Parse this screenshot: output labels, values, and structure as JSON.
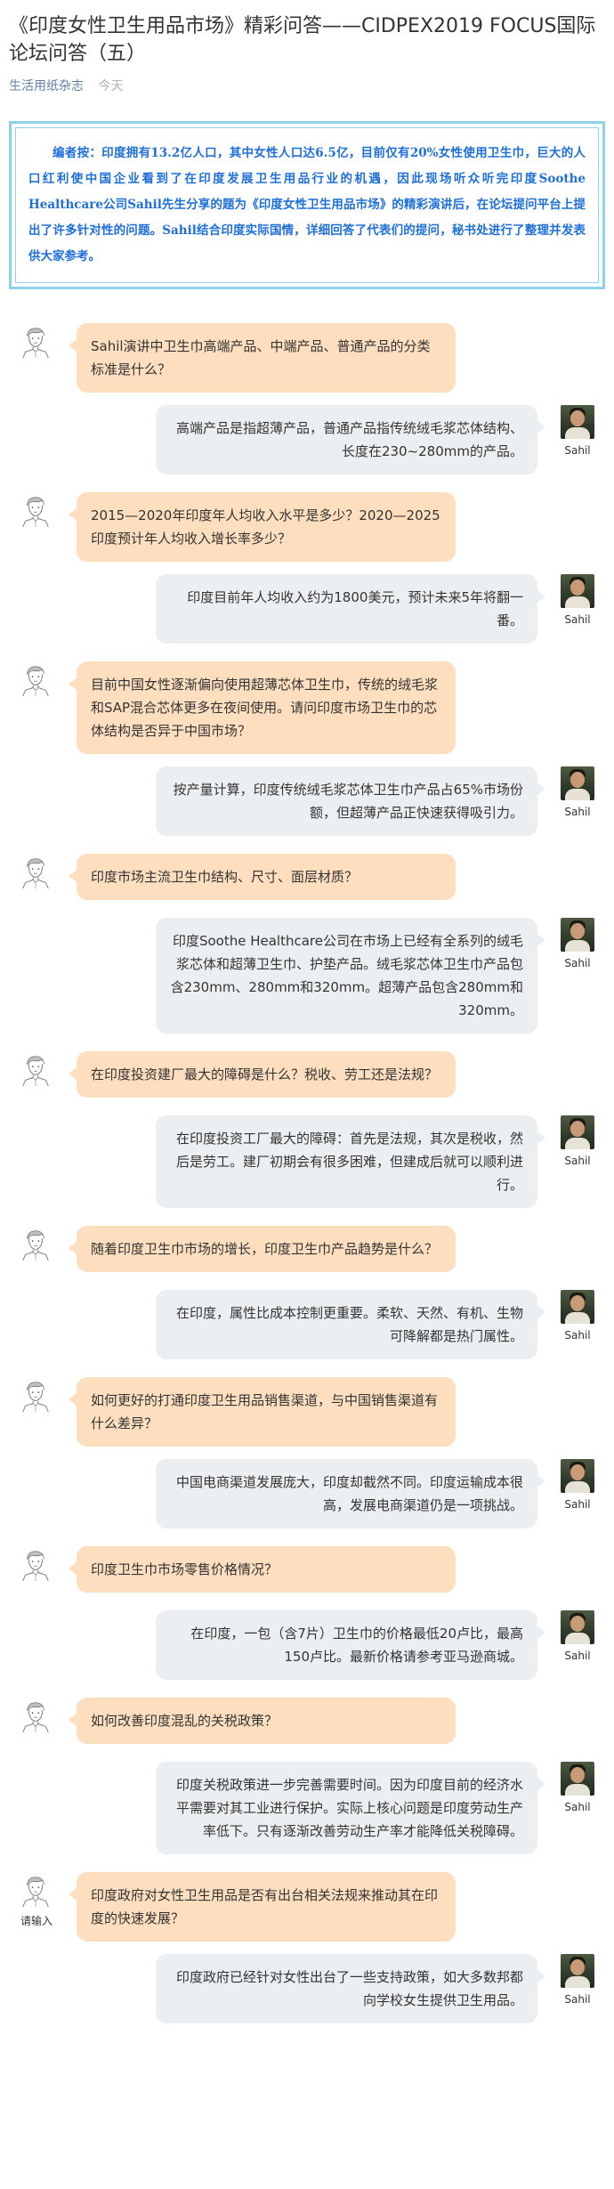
{
  "article": {
    "title": "《印度女性卫生用品市场》精彩问答——CIDPEX2019 FOCUS国际论坛问答（五）",
    "source": "生活用纸杂志",
    "date": "今天"
  },
  "editor_note": "编者按：印度拥有13.2亿人口，其中女性人口达6.5亿，目前仅有20%女性使用卫生巾，巨大的人口红利使中国企业看到了在印度发展卫生用品行业的机遇，因此现场听众听完印度Soothe Healthcare公司Sahil先生分享的题为《印度女性卫生用品市场》的精彩演讲后，在论坛提问平台上提出了许多针对性的问题。Sahil结合印度实际国情，详细回答了代表们的提问，秘书处进行了整理并发表供大家参考。",
  "answerer_name": "Sahil",
  "asker_caption": "请输入",
  "qa": [
    {
      "question": "Sahil演讲中卫生巾高端产品、中端产品、普通产品的分类标准是什么？",
      "answer": "高端产品是指超薄产品，普通产品指传统绒毛浆芯体结构、长度在230~280mm的产品。"
    },
    {
      "question": "2015—2020年印度年人均收入水平是多少？2020—2025印度预计年人均收入增长率多少？",
      "answer": "印度目前年人均收入约为1800美元，预计未来5年将翻一番。"
    },
    {
      "question": "目前中国女性逐渐偏向使用超薄芯体卫生巾，传统的绒毛浆和SAP混合芯体更多在夜间使用。请问印度市场卫生巾的芯体结构是否异于中国市场？",
      "answer": "按产量计算，印度传统绒毛浆芯体卫生巾产品占65%市场份额，但超薄产品正快速获得吸引力。"
    },
    {
      "question": "印度市场主流卫生巾结构、尺寸、面层材质？",
      "answer": "印度Soothe Healthcare公司在市场上已经有全系列的绒毛浆芯体和超薄卫生巾、护垫产品。绒毛浆芯体卫生巾产品包含230mm、280mm和320mm。超薄产品包含280mm和320mm。"
    },
    {
      "question": "在印度投资建厂最大的障碍是什么？税收、劳工还是法规？",
      "answer": "在印度投资工厂最大的障碍：首先是法规，其次是税收，然后是劳工。建厂初期会有很多困难，但建成后就可以顺利进行。"
    },
    {
      "question": "随着印度卫生巾市场的增长，印度卫生巾产品趋势是什么？",
      "answer": "在印度，属性比成本控制更重要。柔软、天然、有机、生物可降解都是热门属性。"
    },
    {
      "question": "如何更好的打通印度卫生用品销售渠道，与中国销售渠道有什么差异？",
      "answer": "中国电商渠道发展庞大，印度却截然不同。印度运输成本很高，发展电商渠道仍是一项挑战。"
    },
    {
      "question": "印度卫生巾市场零售价格情况？",
      "answer": "在印度，一包（含7片）卫生巾的价格最低20卢比，最高150卢比。最新价格请参考亚马逊商城。"
    },
    {
      "question": "如何改善印度混乱的关税政策？",
      "answer": "印度关税政策进一步完善需要时间。因为印度目前的经济水平需要对其工业进行保护。实际上核心问题是印度劳动生产率低下。只有逐渐改善劳动生产率才能降低关税障碍。"
    },
    {
      "question": "印度政府对女性卫生用品是否有出台相关法规来推动其在印度的快速发展？",
      "answer": "印度政府已经针对女性出台了一些支持政策，如大多数邦都向学校女生提供卫生用品。"
    }
  ]
}
